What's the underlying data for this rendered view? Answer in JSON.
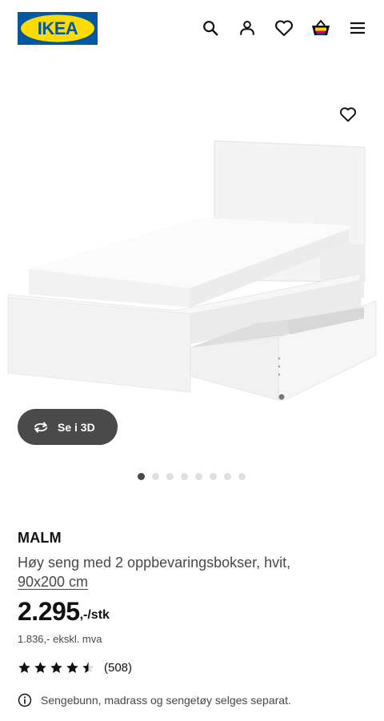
{
  "header": {
    "logo_text": "IKEA",
    "icons": [
      "search-icon",
      "user-icon",
      "heart-icon",
      "basket-icon",
      "menu-icon"
    ]
  },
  "gallery": {
    "button_3d_label": "Se i 3D",
    "image_count": 8,
    "active_image": 1
  },
  "product": {
    "name": "MALM",
    "description": "Høy seng med 2 oppbevaringsbokser, hvit,",
    "size": "90x200 cm",
    "price": "2.295",
    "price_suffix": ",-/stk",
    "price_ex_vat": "1.836,- ekskl. mva",
    "rating_value": 4.5,
    "rating_max": 5,
    "rating_count": "(508)",
    "notice": "Sengebunn, madrass og sengetøy selges separat."
  },
  "colors": {
    "brand_blue": "#0058a3",
    "brand_yellow": "#ffdb00",
    "text": "#111111",
    "muted_text": "#484848",
    "button_dark": "#4a4a4a"
  }
}
